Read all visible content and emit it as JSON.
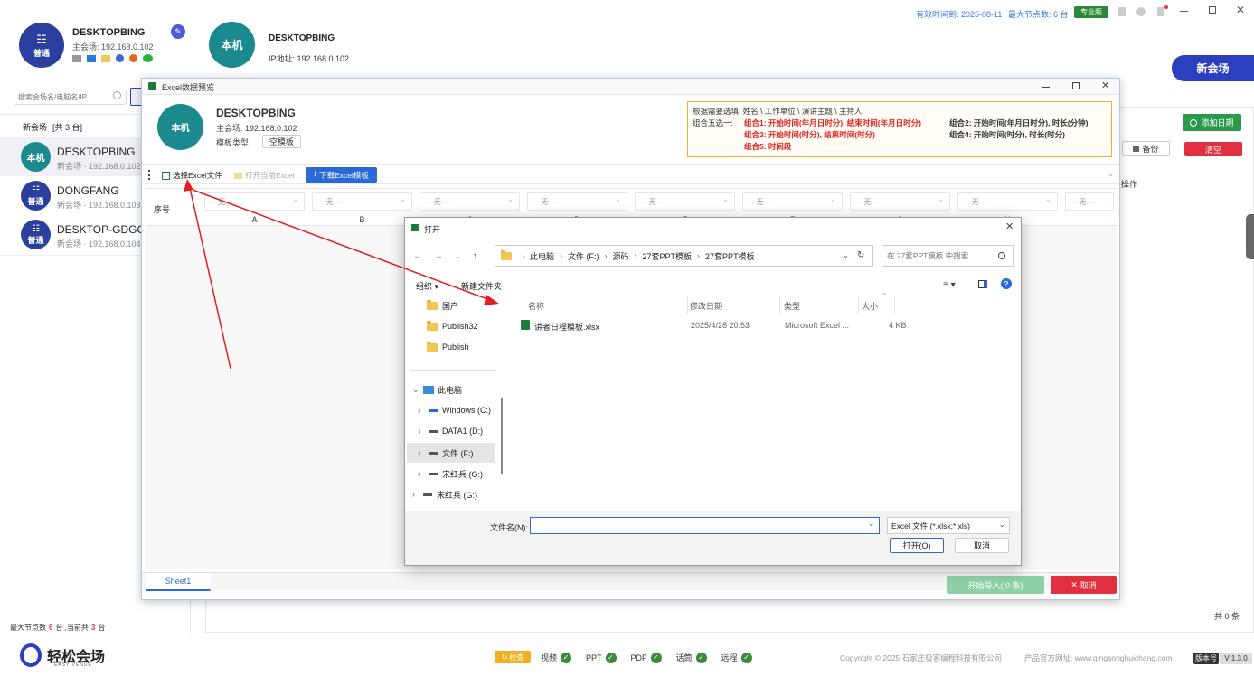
{
  "header": {
    "left_device": {
      "avatar": "普通",
      "name": "DESKTOPBING",
      "ip": "主会场: 192.168.0.102"
    },
    "local": {
      "avatar": "本机",
      "name": "DESKTOPBING",
      "ip": "IP地址: 192.168.0.102"
    },
    "expiry": "有效时间到: 2025-08-11",
    "max_nodes": "最大节点数: 6 台",
    "edition": "专业版",
    "new_venue": "新会场"
  },
  "sidebar": {
    "search_placeholder": "搜索会场名/电脑名/IP",
    "group_label": "新会场",
    "group_count": "[共 3 台]",
    "devices": [
      {
        "avatar": "本机",
        "name": "DESKTOPBING",
        "sub": "新会场 · 192.168.0.102"
      },
      {
        "avatar": "普通",
        "name": "DONGFANG",
        "sub": "新会场 · 192.168.0.103"
      },
      {
        "avatar": "普通",
        "name": "DESKTOP-GDGG5",
        "sub": "新会场 · 192.168.0.104"
      }
    ],
    "footer_prefix": "最大节点数",
    "footer_max": "6",
    "footer_mid": "台 ,当前共",
    "footer_count": "3",
    "footer_suffix": "台"
  },
  "right_panel": {
    "add_date": "添加日期",
    "backup": "备份",
    "clear": "清空",
    "ops_header": "操作",
    "total": "共 0 条"
  },
  "excel_window": {
    "title": "Excel数据预览",
    "device": {
      "avatar": "本机",
      "name": "DESKTOPBING",
      "ip": "主会场: 192.168.0.102",
      "template_label": "模板类型:",
      "template_value": "空模板"
    },
    "hint": {
      "line1": "根据需要选填: 姓名 \\ 工作单位 \\ 演讲主题 \\ 主持人",
      "pick": "组合五选一:",
      "g1": "组合1: 开始时间(年月日时分), 结束时间(年月日时分)",
      "g2": "组合2: 开始时间(年月日时分), 时长(分钟)",
      "g3": "组合3: 开始时间(时分), 结束时间(时分)",
      "g4": "组合4: 开始时间(时分), 时长(时分)",
      "g5": "组合5: 时间段"
    },
    "toolbar": {
      "select": "选择Excel文件",
      "open_current": "打开当前Excel",
      "download": "下载Excel模板"
    },
    "grid": {
      "seq": "序号",
      "placeholder": "----无----",
      "columns": [
        "A",
        "B",
        "C",
        "D",
        "E",
        "F",
        "G",
        "H"
      ]
    },
    "sheet_tab": "Sheet1",
    "start_import": "开始导入( 0 条)",
    "cancel": "取消"
  },
  "dialog": {
    "title": "打开",
    "breadcrumb": [
      "此电脑",
      "文件 (F:)",
      "源码",
      "27套PPT模板",
      "27套PPT模板"
    ],
    "search_placeholder": "在 27套PPT模板 中搜索",
    "organize": "组织 ▾",
    "new_folder": "新建文件夹",
    "tree": [
      "国产",
      "Publish32",
      "Publish",
      "此电脑",
      "Windows (C:)",
      "DATA1 (D:)",
      "文件 (F:)",
      "宋红兵 (G:)",
      "宋红兵 (G:)"
    ],
    "columns": {
      "name": "名称",
      "date": "修改日期",
      "type": "类型",
      "size": "大小"
    },
    "file": {
      "name": "讲者日程模板.xlsx",
      "date": "2025/4/28 20:53",
      "type": "Microsoft Excel ...",
      "size": "4 KB"
    },
    "filename_label": "文件名(N):",
    "filename_value": "",
    "filter": "Excel 文件 (*.xlsx;*.xls)",
    "open": "打开(O)",
    "cancel": "取消"
  },
  "statusbar": {
    "check": "检查",
    "items": [
      "视频",
      "PPT",
      "PDF",
      "话筒",
      "远程"
    ],
    "copyright": "Copyright © 2025 石家庄极客编程科技有限公司",
    "website": "产品官方网址: www.qingsonghuichang.com",
    "version_label": "版本号",
    "version": "V 1.3.0",
    "logo": "轻松会场",
    "logo_sub": "EASY VENUE"
  }
}
